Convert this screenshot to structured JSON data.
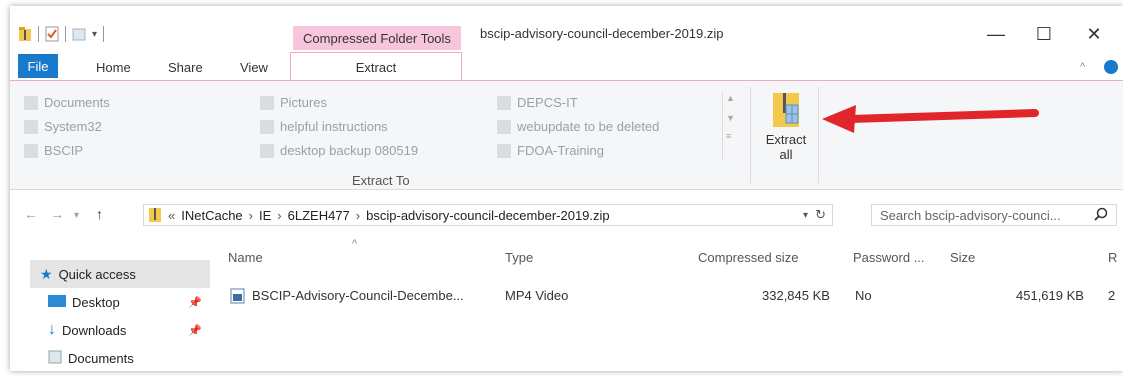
{
  "window": {
    "title": "bscip-advisory-council-december-2019.zip",
    "context_tab": "Compressed Folder Tools",
    "controls": {
      "minimize": "—",
      "maximize": "☐",
      "close": "✕"
    }
  },
  "ribbon_tabs": [
    "File",
    "Home",
    "Share",
    "View",
    "Extract"
  ],
  "extract_to": {
    "label": "Extract To",
    "destinations": [
      [
        "Documents",
        "Pictures",
        "DEPCS-IT"
      ],
      [
        "System32",
        "helpful instructions",
        "webupdate to be deleted"
      ],
      [
        "BSCIP",
        "desktop backup 080519",
        "FDOA-Training"
      ]
    ]
  },
  "extract_all": {
    "line1": "Extract",
    "line2": "all"
  },
  "address": {
    "prefix": "«",
    "crumbs": [
      "INetCache",
      "IE",
      "6LZEH477",
      "bscip-advisory-council-december-2019.zip"
    ]
  },
  "search": {
    "placeholder": "Search bscip-advisory-counci..."
  },
  "nav_pane": {
    "quick_access": "Quick access",
    "items": [
      "Desktop",
      "Downloads",
      "Documents"
    ]
  },
  "columns": [
    "Name",
    "Type",
    "Compressed size",
    "Password ...",
    "Size",
    "R"
  ],
  "files": [
    {
      "name": "BSCIP-Advisory-Council-Decembe...",
      "type": "MP4 Video",
      "compressed": "332,845 KB",
      "password": "No",
      "size": "451,619 KB",
      "ratio": "2"
    }
  ],
  "colors": {
    "accent": "#1979ca",
    "context_tab": "#f7c6dc",
    "arrow": "#e0262a"
  }
}
